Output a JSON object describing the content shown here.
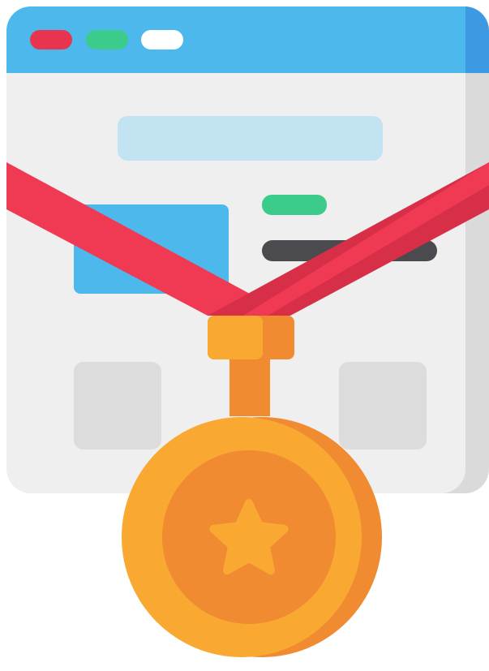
{
  "illustration": {
    "subject": "medal-over-browser-window-icon",
    "colors": {
      "titlebar": "#4DB8EC",
      "titlebar_right": "#3D9AE2",
      "window_body": "#EFEFEF",
      "window_body_right": "#DADADA",
      "dot_red": "#E8344E",
      "dot_green": "#3BCB8B",
      "dot_white": "#FFFFFF",
      "search_bar": "#C2E4F2",
      "image_block": "#4DB8EC",
      "text_line_green": "#3BCB8B",
      "text_line_dark": "#4A4A4F",
      "card_placeholder": "#DCDCDC",
      "ribbon": "#F03A53",
      "ribbon_shade": "#D72F47",
      "medal_gold": "#F9A932",
      "medal_orange": "#F08B31",
      "star": "#F9A932"
    },
    "icons": [
      "window-close-dot-icon",
      "window-minimize-dot-icon",
      "window-maximize-dot-icon",
      "medal-icon",
      "star-icon"
    ]
  }
}
